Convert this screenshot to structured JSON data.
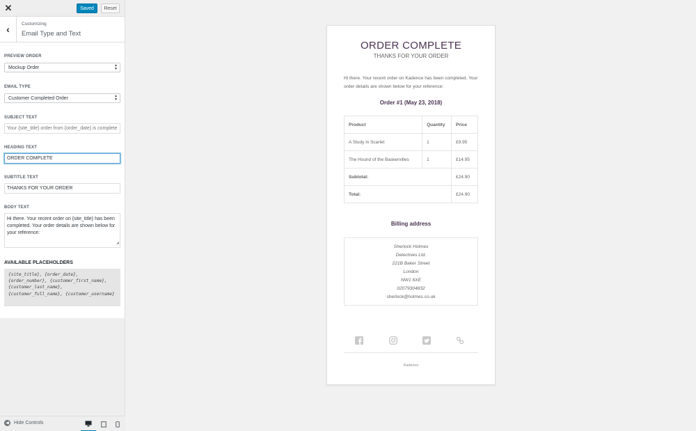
{
  "header": {
    "close_icon": "close-icon",
    "saved_label": "Saved",
    "reset_label": "Reset"
  },
  "panel": {
    "breadcrumb": "Customizing",
    "section_title": "Email Type and Text"
  },
  "controls": {
    "preview_order": {
      "label": "PREVIEW ORDER",
      "value": "Mockup Order"
    },
    "email_type": {
      "label": "EMAIL TYPE",
      "value": "Customer Completed Order"
    },
    "subject_text": {
      "label": "SUBJECT TEXT",
      "placeholder": "Your {site_title} order from {order_date} is complete"
    },
    "heading_text": {
      "label": "HEADING TEXT",
      "value": "ORDER COMPLETE"
    },
    "subtitle_text": {
      "label": "SUBTITLE TEXT",
      "value": "THANKS FOR YOUR ORDER"
    },
    "body_text": {
      "label": "BODY TEXT",
      "value": "Hi there. Your recent order on {site_title} has been completed. Your order details are shown below for your reference:"
    }
  },
  "placeholders": {
    "title": "AVAILABLE PLACEHOLDERS",
    "text": "{site_title}, {order_date}, {order_number}, {customer_first_name}, {customer_last_name}, {customer_full_name}, {customer_username}"
  },
  "footer": {
    "hide_controls": "Hide Controls",
    "devices": [
      "desktop",
      "tablet",
      "mobile"
    ],
    "active_device": "desktop"
  },
  "email": {
    "heading": "ORDER COMPLETE",
    "subtitle": "THANKS FOR YOUR ORDER",
    "body": "Hi there. Your recent order on Kadence has been completed. Your order details are shown below for your reference:",
    "order_title": "Order #1 (May 23, 2018)",
    "table": {
      "headers": [
        "Product",
        "Quantity",
        "Price"
      ],
      "rows": [
        {
          "product": "A Study in Scarlet",
          "quantity": "1",
          "price": "£9.95"
        },
        {
          "product": "The Hound of the Baskervilles",
          "quantity": "1",
          "price": "£14.95"
        }
      ],
      "subtotal_label": "Subtotal:",
      "subtotal_value": "£24.90",
      "total_label": "Total:",
      "total_value": "£24.90"
    },
    "billing_title": "Billing address",
    "address": {
      "name": "Sherlock Holmes",
      "company": "Detectives Ltd.",
      "street": "221B Baker Street",
      "city": "London",
      "postcode": "NW1 6XE",
      "phone": "02079304832",
      "email": "sherlock@holmes.co.uk"
    },
    "social_icons": [
      "facebook-icon",
      "instagram-icon",
      "twitter-icon",
      "link-icon"
    ],
    "footer_text": "Kadence"
  },
  "colors": {
    "primary_button": "#0085ba",
    "heading": "#4a3351",
    "body_text": "#636363"
  }
}
